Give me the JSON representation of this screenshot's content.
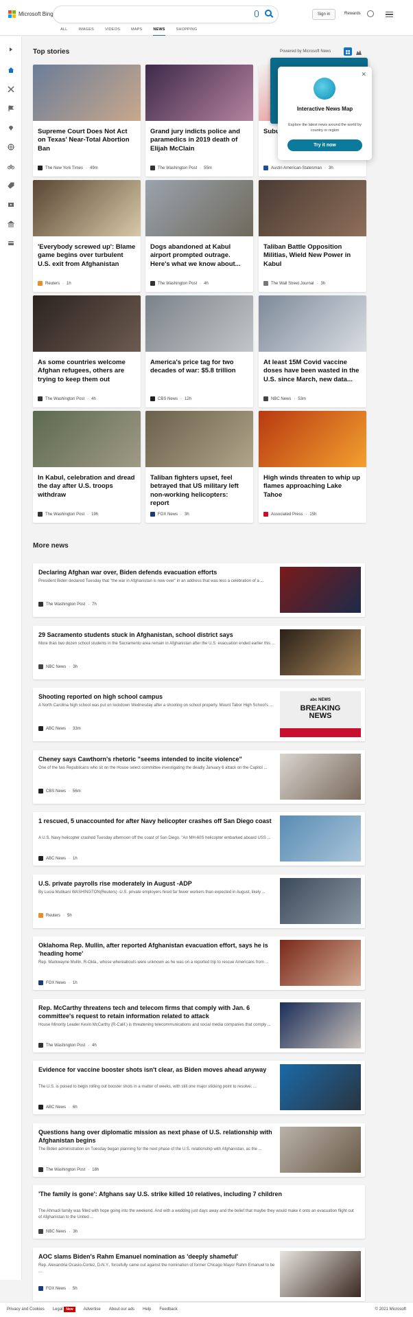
{
  "header": {
    "logo_text": "Microsoft Bing",
    "signin": "Sign in",
    "rewards": "Rewards",
    "nav": [
      "ALL",
      "IMAGES",
      "VIDEOS",
      "MAPS",
      "NEWS",
      "SHOPPING"
    ],
    "nav_active": "NEWS"
  },
  "top_stories": {
    "title": "Top stories",
    "powered_by": "Powered by Microsoft News",
    "cards": [
      {
        "title": "Supreme Court Does Not Act on Texas' Near-Total Abortion Ban",
        "source": "The New York Times",
        "time": "49m",
        "logo_color": "#222",
        "img_colors": [
          "#6b7d99",
          "#c9a88c"
        ]
      },
      {
        "title": "Grand jury indicts police and paramedics in 2019 death of Elijah McClain",
        "source": "The Washington Post",
        "time": "55m",
        "logo_color": "#333",
        "img_colors": [
          "#3d2a4a",
          "#b4839e"
        ]
      },
      {
        "title": "Suburb closes junior",
        "source": "Austin American-Statesman",
        "time": "3h",
        "logo_color": "#1d4fa0",
        "img_colors": [
          "#f4f4f4",
          "#d63a3a"
        ]
      },
      {
        "title": "'Everybody screwed up': Blame game begins over turbulent U.S. exit from Afghanistan",
        "source": "Reuters",
        "time": "1h",
        "logo_color": "#f08a24",
        "img_colors": [
          "#5a4633",
          "#d8c9a8"
        ]
      },
      {
        "title": "Dogs abandoned at Kabul airport prompted outrage. Here's what we know about...",
        "source": "The Washington Post",
        "time": "4h",
        "logo_color": "#333",
        "img_colors": [
          "#9aa3ad",
          "#6f6a5c"
        ]
      },
      {
        "title": "Taliban Battle Opposition Militias, Wield New Power in Kabul",
        "source": "The Wall Street Journal",
        "time": "3h",
        "logo_color": "#777",
        "img_colors": [
          "#4a3b33",
          "#8e6f5a"
        ]
      },
      {
        "title": "As some countries welcome Afghan refugees, others are trying to keep them out",
        "source": "The Washington Post",
        "time": "4h",
        "logo_color": "#333",
        "img_colors": [
          "#2b2320",
          "#6d5b50"
        ]
      },
      {
        "title": "America's price tag for two decades of war: $5.8 trillion",
        "source": "CBS News",
        "time": "12h",
        "logo_color": "#222",
        "img_colors": [
          "#7a828a",
          "#c3c6c7"
        ]
      },
      {
        "title": "At least 15M Covid vaccine doses have been wasted in the U.S. since March, new data...",
        "source": "NBC News",
        "time": "53m",
        "logo_color": "#444",
        "img_colors": [
          "#7e8a9a",
          "#d9dde2"
        ]
      },
      {
        "title": "In Kabul, celebration and dread the day after U.S. troops withdraw",
        "source": "The Washington Post",
        "time": "19h",
        "logo_color": "#333",
        "img_colors": [
          "#5b6a4e",
          "#a09a86"
        ]
      },
      {
        "title": "Taliban fighters upset, feel betrayed that US military left non-working helicopters: report",
        "source": "FOX News",
        "time": "3h",
        "logo_color": "#1b3c7a",
        "img_colors": [
          "#6b604a",
          "#b0a48a"
        ]
      },
      {
        "title": "High winds threaten to whip up flames approaching Lake Tahoe",
        "source": "Associated Press",
        "time": "15h",
        "logo_color": "#c8102e",
        "img_colors": [
          "#b83a10",
          "#f2a030"
        ]
      }
    ]
  },
  "popup": {
    "title": "Interactive News Map",
    "description": "Explore the latest news around the world by country or region",
    "button": "Try it now",
    "close": "✕"
  },
  "more_news": {
    "title": "More news",
    "items": [
      {
        "title": "Declaring Afghan war over, Biden defends evacuation efforts",
        "snippet": "President Biden declared Tuesday that \"the war in Afghanistan is now over\" in an address that was less a celebration of a ...",
        "source": "The Washington Post",
        "time": "7h",
        "logo_color": "#333",
        "img_colors": [
          "#7a1a1a",
          "#1c2b4a"
        ]
      },
      {
        "title": "29 Sacramento students stuck in Afghanistan, school district says",
        "snippet": "More than two dozen school students in the Sacramento area remain in Afghanistan after the U.S. evacuation ended earlier this ...",
        "source": "NBC News",
        "time": "3h",
        "logo_color": "#444",
        "img_colors": [
          "#2a2118",
          "#a8875a"
        ]
      },
      {
        "title": "Shooting reported on high school campus",
        "snippet": "A North Carolina high school was put on lockdown Wednesday after a shooting on school property. Mount Tabor High School's ...",
        "source": "ABC News",
        "time": "33m",
        "logo_color": "#222",
        "img_colors": [
          "#eeeeee",
          "#c8102e"
        ],
        "img_text_top": "abc NEWS",
        "img_text_main": "BREAKING NEWS"
      },
      {
        "title": "Cheney says Cawthorn's rhetoric \"seems intended to incite violence\"",
        "snippet": "One of the two Republicans who sit on the House select committee investigating the deadly January 6 attack on the Capitol ...",
        "source": "CBS News",
        "time": "56m",
        "logo_color": "#222",
        "img_colors": [
          "#d8d4cf",
          "#7a6a5c"
        ]
      },
      {
        "title": "1 rescued, 5 unaccounted for after Navy helicopter crashes off San Diego coast",
        "snippet": "A U.S. Navy helicopter crashed Tuesday afternoon off the coast of San Diego. \"An MH-60S helicopter embarked aboard USS ...",
        "source": "ABC News",
        "time": "1h",
        "logo_color": "#222",
        "img_colors": [
          "#5a8cb4",
          "#a8c4d8"
        ]
      },
      {
        "title": "U.S. private payrolls rise moderately in August -ADP",
        "snippet": "By Lucia Mutikani WASHINGTON(Reuters) -U.S. private employers hired far fewer workers than expected in August, likely ...",
        "source": "Reuters",
        "time": "5h",
        "logo_color": "#f08a24",
        "img_colors": [
          "#3b4a5a",
          "#8a97a3"
        ]
      },
      {
        "title": "Oklahoma Rep. Mullin, after reported Afghanistan evacuation effort, says he is 'heading home'",
        "snippet": "Rep. Markwayne Mullin, R-Okla., whose whereabouts were unknown as he was on a reported trip to rescue Americans from ...",
        "source": "FOX News",
        "time": "1h",
        "logo_color": "#1b3c7a",
        "img_colors": [
          "#7a2a1a",
          "#d0a890"
        ]
      },
      {
        "title": "Rep. McCarthy threatens tech and telecom firms that comply with Jan. 6 committee's request to retain information related to attack",
        "snippet": "House Minority Leader Kevin McCarthy (R-Calif.) is threatening telecommunications and social media companies that comply ...",
        "source": "The Washington Post",
        "time": "4h",
        "logo_color": "#333",
        "img_colors": [
          "#1c2f5a",
          "#c8c0b8"
        ]
      },
      {
        "title": "Evidence for vaccine booster shots isn't clear, as Biden moves ahead anyway",
        "snippet": "The U.S. is poised to begin rolling out booster shots in a matter of weeks, with still one major sticking point to resolve: ...",
        "source": "ABC News",
        "time": "6h",
        "logo_color": "#222",
        "img_colors": [
          "#1a6aa8",
          "#2a3440"
        ]
      },
      {
        "title": "Questions hang over diplomatic mission as next phase of U.S. relationship with Afghanistan begins",
        "snippet": "The Biden administration on Tuesday began planning for the next phase of the U.S. relationship with Afghanistan, as the ...",
        "source": "The Washington Post",
        "time": "18h",
        "logo_color": "#333",
        "img_colors": [
          "#b8b2a8",
          "#6a5a48"
        ]
      },
      {
        "title": "'The family is gone': Afghans say U.S. strike killed 10 relatives, including 7 children",
        "snippet": "The Ahmadi family was filled with hope going into the weekend. And with a wedding just days away and the belief that maybe they would make it onto an evacuation flight out of Afghanistan to the United ...",
        "source": "NBC News",
        "time": "3h",
        "logo_color": "#444",
        "img_colors": null
      },
      {
        "title": "AOC slams Biden's Rahm Emanuel nomination as 'deeply shameful'",
        "snippet": "Rep. Alexandria Ocasio-Cortez, D-N.Y., forcefully came out against the nomination of former Chicago Mayor Rahm Emanuel to be ...",
        "source": "FOX News",
        "time": "5h",
        "logo_color": "#1b3c7a",
        "img_colors": [
          "#e8e4e0",
          "#3a2a22"
        ]
      }
    ]
  },
  "footer": {
    "links": [
      "Privacy and Cookies",
      "Legal",
      "Advertise",
      "About our ads",
      "Help",
      "Feedback"
    ],
    "new_badge": "New",
    "copyright": "© 2021 Microsoft"
  },
  "colors": {
    "accent": "#0a73c9",
    "popup_button": "#0b7a9c"
  }
}
